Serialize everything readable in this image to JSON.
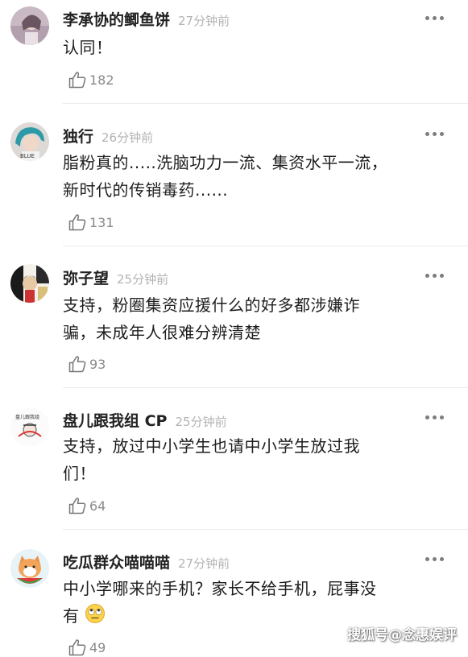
{
  "comments": [
    {
      "username": "李承协的鲫鱼饼",
      "time": "27分钟前",
      "text": [
        "认同！"
      ],
      "likes": "182"
    },
    {
      "username": "独行",
      "time": "26分钟前",
      "text": [
        "脂粉真的.....洗脑功力一流、集资水平一流，",
        "新时代的传销毒药......"
      ],
      "likes": "131"
    },
    {
      "username": "弥子望",
      "time": "25分钟前",
      "text": [
        "支持，粉圈集资应援什么的好多都涉嫌诈",
        "骗，未成年人很难分辨清楚"
      ],
      "likes": "93"
    },
    {
      "username": "盘儿跟我组 CP",
      "time": "25分钟前",
      "text": [
        "支持，放过中小学生也请中小学生放过我",
        "们！"
      ],
      "likes": "64"
    },
    {
      "username": "吃瓜群众喵喵喵",
      "time": "27分钟前",
      "text": [
        "中小学哪来的手机？家长不给手机，屁事没",
        "有"
      ],
      "likes": "49"
    }
  ],
  "avatar_texts": {
    "c2": "BLUE",
    "c4": "盘儿跟我组"
  },
  "emoji_icon": "rolling-eyes-emoji-icon",
  "watermark": "搜狐号@念惠娱评"
}
